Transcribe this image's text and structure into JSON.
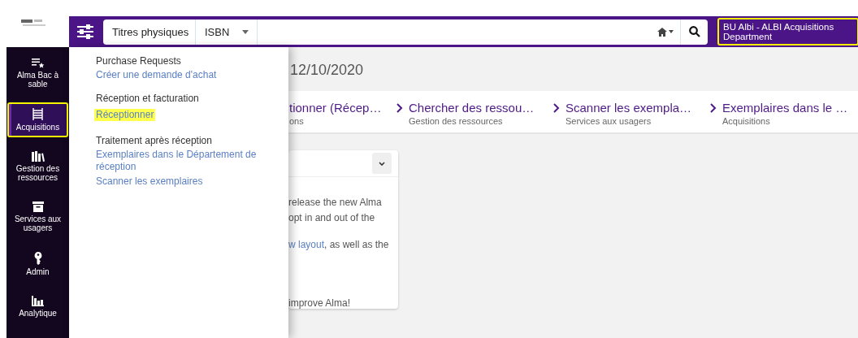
{
  "search": {
    "scope": "Titres physiques",
    "field": "ISBN"
  },
  "institution": {
    "label": "BU Albi - ALBI Acquisitions Department",
    "highlighted": true
  },
  "sidebar": {
    "items": [
      {
        "label": "Alma Bac à sable",
        "kind": "list-star",
        "selected": false,
        "highlighted": false
      },
      {
        "label": "Acquisitions",
        "kind": "abacus",
        "selected": true,
        "highlighted": true
      },
      {
        "label": "Gestion des ressources",
        "kind": "books",
        "selected": false,
        "highlighted": false
      },
      {
        "label": "Services aux usagers",
        "kind": "archive",
        "selected": false,
        "highlighted": false
      },
      {
        "label": "Admin",
        "kind": "key",
        "selected": false,
        "highlighted": false
      },
      {
        "label": "Analytique",
        "kind": "bars",
        "selected": false,
        "highlighted": false
      }
    ]
  },
  "menu": {
    "groups": [
      {
        "title": "Purchase Requests",
        "links": [
          {
            "label": "Créer une demande d'achat",
            "highlighted": false
          }
        ]
      },
      {
        "title": "Réception et facturation",
        "links": [
          {
            "label": "Réceptionner",
            "highlighted": true
          }
        ]
      },
      {
        "title": "Traitement après réception",
        "links": [
          {
            "label": "Exemplaires dans le Département de réception",
            "highlighted": false
          },
          {
            "label": "Scanner les exemplaires",
            "highlighted": false
          }
        ]
      }
    ]
  },
  "main": {
    "date": "12/10/2020",
    "shortcuts": [
      {
        "title": "tionner (Récep…",
        "subtitle": "ons"
      },
      {
        "title": "Chercher des ressou…",
        "subtitle": "Gestion des ressources"
      },
      {
        "title": "Scanner les exempla…",
        "subtitle": "Services aux usagers"
      },
      {
        "title": "Exemplaires dans le …",
        "subtitle": "Acquisitions"
      }
    ],
    "card": {
      "paragraphs": [
        {
          "text": "release the new Alma\nopt in and out of the"
        },
        {
          "link": "w layout",
          "text": ", as well as the"
        },
        {
          "text": "improve Alma!"
        }
      ]
    }
  }
}
